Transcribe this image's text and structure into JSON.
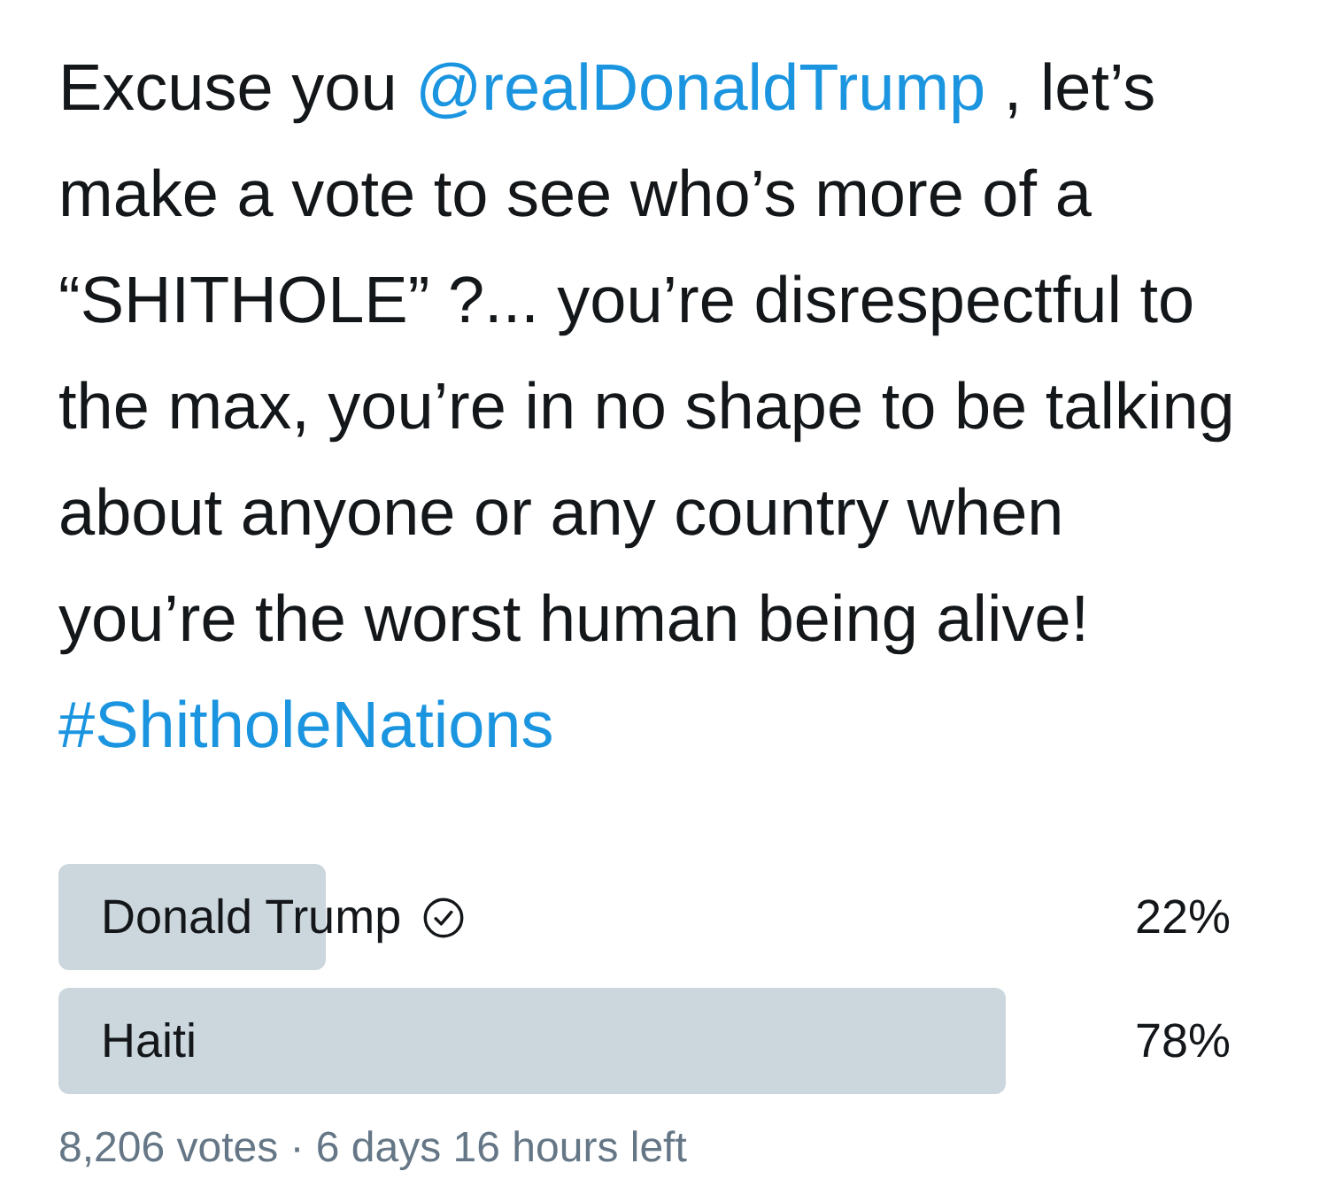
{
  "tweet": {
    "segments": [
      {
        "kind": "text",
        "text": "Excuse you "
      },
      {
        "kind": "mention",
        "text": "@realDonaldTrump"
      },
      {
        "kind": "text",
        "text": " , let’s\nmake a vote to see who’s more of a\n“SHITHOLE” ?... you’re disrespectful to\nthe max, you’re in no shape to be talking\nabout anyone or any country when\nyou’re the worst human being alive!\n"
      },
      {
        "kind": "hashtag",
        "text": "#ShitholeNations"
      }
    ]
  },
  "poll": {
    "options": [
      {
        "label": "Donald Trump",
        "percent": "22%",
        "level": 0.22,
        "selected": true
      },
      {
        "label": "Haiti",
        "percent": "78%",
        "level": 0.78,
        "selected": false
      }
    ],
    "status": "8,206 votes · 6 days 16 hours left"
  }
}
